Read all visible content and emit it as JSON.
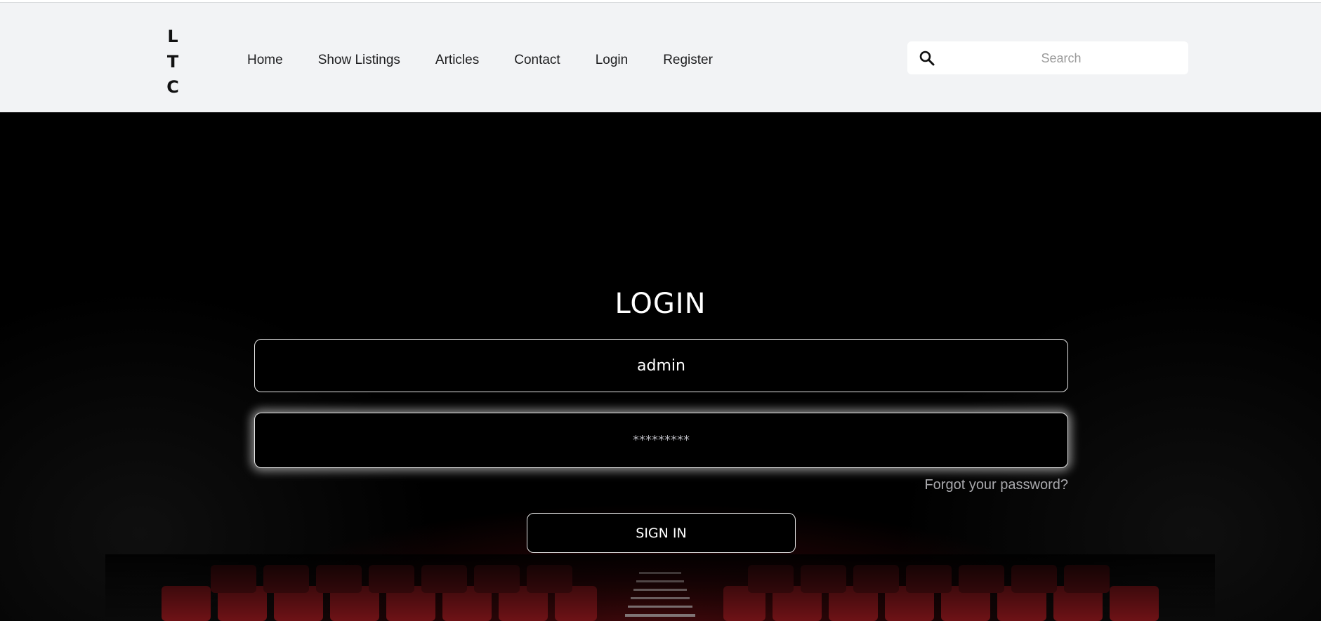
{
  "logo": {
    "letters": [
      "L",
      "T",
      "C"
    ]
  },
  "nav": {
    "items": [
      {
        "label": "Home"
      },
      {
        "label": "Show Listings"
      },
      {
        "label": "Articles"
      },
      {
        "label": "Contact"
      },
      {
        "label": "Login"
      },
      {
        "label": "Register"
      }
    ]
  },
  "search": {
    "placeholder": "Search",
    "icon": "search-icon"
  },
  "login_form": {
    "title": "LOGIN",
    "username_value": "admin",
    "password_placeholder": "*********",
    "forgot_label": "Forgot your password?",
    "submit_label": "SIGN IN"
  },
  "colors": {
    "header_bg": "#f2f3f5",
    "hero_bg": "#000000",
    "seat_red": "#7a1518",
    "text_light": "#ffffff",
    "muted_link": "#a9a9ad"
  }
}
